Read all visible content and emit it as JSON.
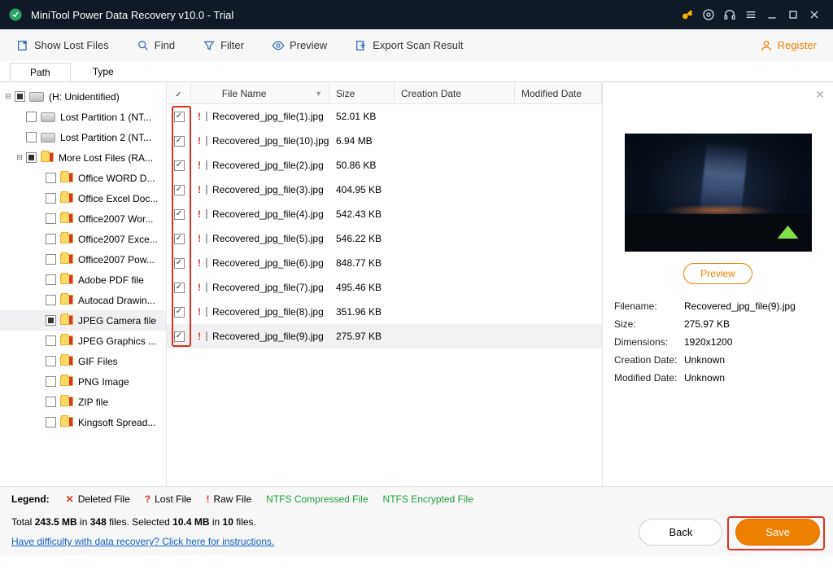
{
  "titlebar": {
    "title": "MiniTool Power Data Recovery v10.0 - Trial"
  },
  "toolbar": {
    "show_lost": "Show Lost Files",
    "find": "Find",
    "filter": "Filter",
    "preview": "Preview",
    "export": "Export Scan Result",
    "register": "Register"
  },
  "tabs": {
    "path": "Path",
    "type": "Type"
  },
  "tree": {
    "root": "(H: Unidentified)",
    "items": [
      {
        "label": "Lost Partition 1 (NT...",
        "icon": "drive"
      },
      {
        "label": "Lost Partition 2 (NT...",
        "icon": "drive"
      },
      {
        "label": "More Lost Files (RA...",
        "icon": "folder-red",
        "expanded": true,
        "partial": true,
        "children": [
          {
            "label": "Office WORD D..."
          },
          {
            "label": "Office Excel Doc..."
          },
          {
            "label": "Office2007 Wor..."
          },
          {
            "label": "Office2007 Exce..."
          },
          {
            "label": "Office2007 Pow..."
          },
          {
            "label": "Adobe PDF file"
          },
          {
            "label": "Autocad Drawin..."
          },
          {
            "label": "JPEG Camera file",
            "selected": true,
            "partial": true
          },
          {
            "label": "JPEG Graphics ..."
          },
          {
            "label": "GIF Files"
          },
          {
            "label": "PNG Image"
          },
          {
            "label": "ZIP file"
          },
          {
            "label": "Kingsoft Spread..."
          }
        ]
      }
    ]
  },
  "columns": {
    "name": "File Name",
    "size": "Size",
    "cdate": "Creation Date",
    "mdate": "Modified Date"
  },
  "files": [
    {
      "name": "Recovered_jpg_file(1).jpg",
      "size": "52.01 KB"
    },
    {
      "name": "Recovered_jpg_file(10).jpg",
      "size": "6.94 MB"
    },
    {
      "name": "Recovered_jpg_file(2).jpg",
      "size": "50.86 KB"
    },
    {
      "name": "Recovered_jpg_file(3).jpg",
      "size": "404.95 KB"
    },
    {
      "name": "Recovered_jpg_file(4).jpg",
      "size": "542.43 KB"
    },
    {
      "name": "Recovered_jpg_file(5).jpg",
      "size": "546.22 KB"
    },
    {
      "name": "Recovered_jpg_file(6).jpg",
      "size": "848.77 KB"
    },
    {
      "name": "Recovered_jpg_file(7).jpg",
      "size": "495.46 KB"
    },
    {
      "name": "Recovered_jpg_file(8).jpg",
      "size": "351.96 KB"
    },
    {
      "name": "Recovered_jpg_file(9).jpg",
      "size": "275.97 KB",
      "selected": true
    }
  ],
  "preview": {
    "button": "Preview",
    "meta_keys": {
      "filename": "Filename:",
      "size": "Size:",
      "dimensions": "Dimensions:",
      "cdate": "Creation Date:",
      "mdate": "Modified Date:"
    },
    "meta_vals": {
      "filename": "Recovered_jpg_file(9).jpg",
      "size": "275.97 KB",
      "dimensions": "1920x1200",
      "cdate": "Unknown",
      "mdate": "Unknown"
    }
  },
  "footer": {
    "legend_label": "Legend:",
    "deleted": "Deleted File",
    "lost": "Lost File",
    "raw": "Raw File",
    "ntfs_comp": "NTFS Compressed File",
    "ntfs_enc": "NTFS Encrypted File",
    "stats_a": "Total ",
    "stats_b": "243.5 MB",
    "stats_c": " in ",
    "stats_d": "348",
    "stats_e": " files.  Selected ",
    "stats_f": "10.4 MB",
    "stats_g": " in ",
    "stats_h": "10",
    "stats_i": " files.",
    "help": "Have difficulty with data recovery? Click here for instructions.",
    "back": "Back",
    "save": "Save"
  }
}
